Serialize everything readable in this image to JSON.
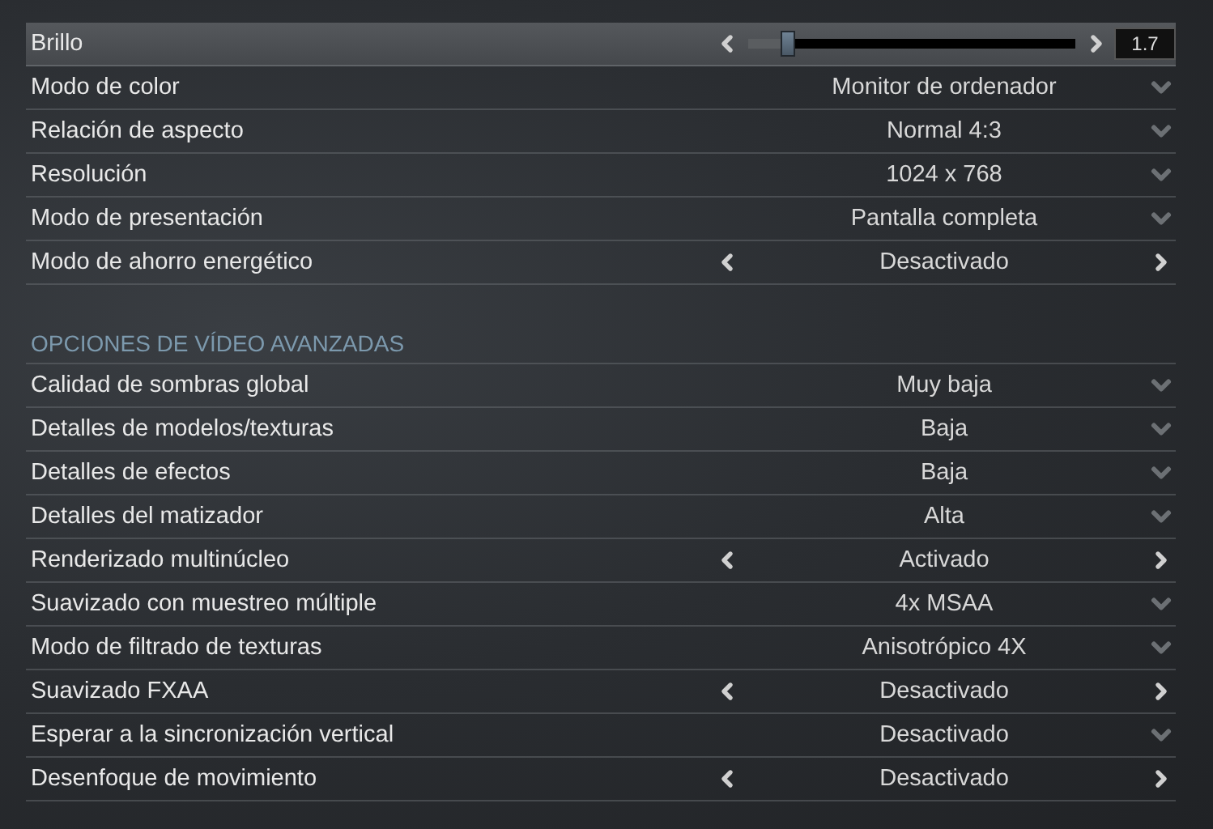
{
  "basic_settings": [
    {
      "label": "Brillo",
      "kind": "slider",
      "selected": true,
      "level": 0.12,
      "reading": "1.7"
    },
    {
      "label": "Modo de color",
      "kind": "dropdown",
      "selected": false,
      "value": "Monitor de ordenador"
    },
    {
      "label": "Relación de aspecto",
      "kind": "dropdown",
      "selected": false,
      "value": "Normal 4:3"
    },
    {
      "label": "Resolución",
      "kind": "dropdown",
      "selected": false,
      "value": "1024 x 768"
    },
    {
      "label": "Modo de presentación",
      "kind": "dropdown",
      "selected": false,
      "value": "Pantalla completa"
    },
    {
      "label": "Modo de ahorro energético",
      "kind": "toggle",
      "selected": false,
      "value": "Desactivado"
    }
  ],
  "advanced_section": {
    "title": "OPCIONES DE VÍDEO AVANZADAS",
    "settings": [
      {
        "label": "Calidad de sombras global",
        "kind": "dropdown",
        "selected": false,
        "value": "Muy baja"
      },
      {
        "label": "Detalles de modelos/texturas",
        "kind": "dropdown",
        "selected": false,
        "value": "Baja"
      },
      {
        "label": "Detalles de efectos",
        "kind": "dropdown",
        "selected": false,
        "value": "Baja"
      },
      {
        "label": "Detalles del matizador",
        "kind": "dropdown",
        "selected": false,
        "value": "Alta"
      },
      {
        "label": "Renderizado multinúcleo",
        "kind": "toggle",
        "selected": false,
        "value": "Activado"
      },
      {
        "label": "Suavizado con muestreo múltiple",
        "kind": "dropdown",
        "selected": false,
        "value": "4x MSAA"
      },
      {
        "label": "Modo de filtrado de texturas",
        "kind": "dropdown",
        "selected": false,
        "value": "Anisotrópico 4X"
      },
      {
        "label": "Suavizado FXAA",
        "kind": "toggle",
        "selected": false,
        "value": "Desactivado"
      },
      {
        "label": "Esperar a la sincronización vertical",
        "kind": "dropdown",
        "selected": false,
        "value": "Desactivado"
      },
      {
        "label": "Desenfoque de movimiento",
        "kind": "toggle",
        "selected": false,
        "value": "Desactivado"
      }
    ]
  }
}
